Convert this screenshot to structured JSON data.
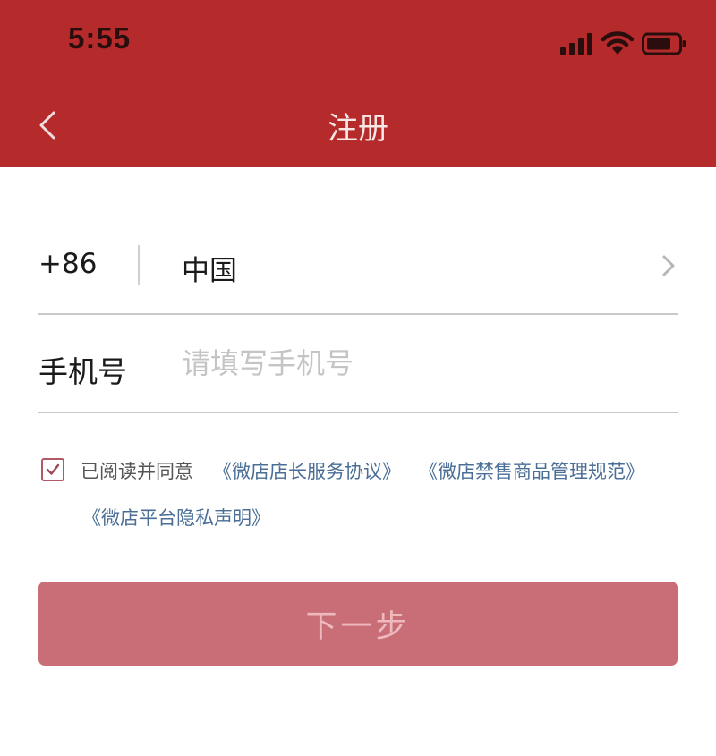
{
  "status_bar": {
    "time": "5:55",
    "icons": [
      "signal-icon",
      "wifi-icon",
      "battery-icon"
    ]
  },
  "nav": {
    "title": "注册",
    "back_icon": "chevron-left-icon"
  },
  "form": {
    "country_code": "+86",
    "country_name": "中国",
    "phone_label": "手机号",
    "phone_placeholder": "请填写手机号",
    "phone_value": ""
  },
  "agreement": {
    "checked": true,
    "prefix": "已阅读并同意",
    "links": [
      "《微店店长服务协议》",
      "《微店禁售商品管理规范》",
      "《微店平台隐私声明》"
    ]
  },
  "next_button": {
    "label": "下一步"
  },
  "colors": {
    "header_bg": "#b52a2a",
    "button_bg": "#c96d76",
    "link": "#4a6e96"
  }
}
